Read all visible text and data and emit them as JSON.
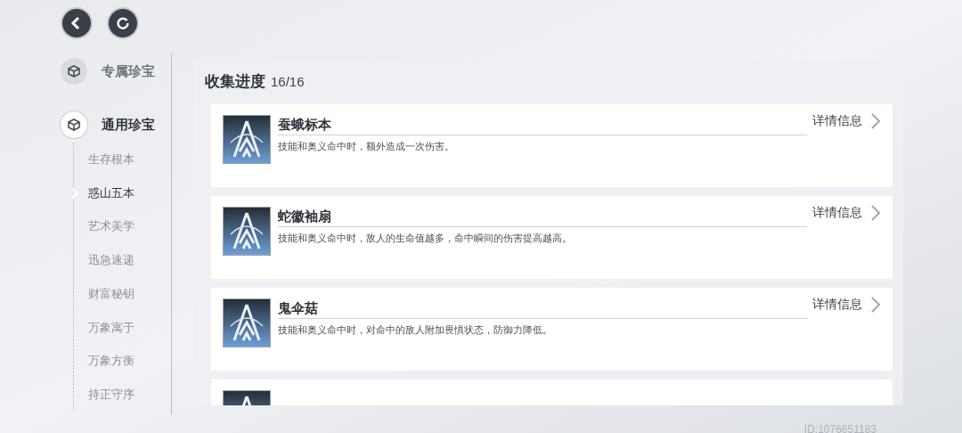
{
  "nav_buttons": [
    {
      "kind": "back"
    },
    {
      "kind": "refresh"
    }
  ],
  "sidebar": {
    "sections": [
      {
        "label": "专属珍宝",
        "selected": false
      },
      {
        "label": "通用珍宝",
        "selected": true,
        "children": [
          {
            "label": "生存根本",
            "selected": false
          },
          {
            "label": "惑山五本",
            "selected": true
          },
          {
            "label": "艺术美学",
            "selected": false
          },
          {
            "label": "迅急速递",
            "selected": false
          },
          {
            "label": "财富秘钥",
            "selected": false
          },
          {
            "label": "万象寓于",
            "selected": false
          },
          {
            "label": "万象方衡",
            "selected": false
          },
          {
            "label": "持正守序",
            "selected": false
          }
        ]
      }
    ]
  },
  "panel": {
    "title": "收集进度",
    "progress": "16/16",
    "cards": [
      {
        "name": "蚕蛾标本",
        "description": "技能和奥义命中时，额外造成一次伤害。",
        "detail": "详情信息"
      },
      {
        "name": "蛇徽袖扇",
        "description": "技能和奥义命中时，敌人的生命值越多，命中瞬间的伤害提高越高。",
        "detail": "详情信息"
      },
      {
        "name": "鬼伞菇",
        "description": "技能和奥义命中时，对命中的敌人附加畏惧状态，防御力降低。",
        "detail": "详情信息"
      }
    ],
    "more_below": true
  },
  "user_id": "ID:1076651183"
}
